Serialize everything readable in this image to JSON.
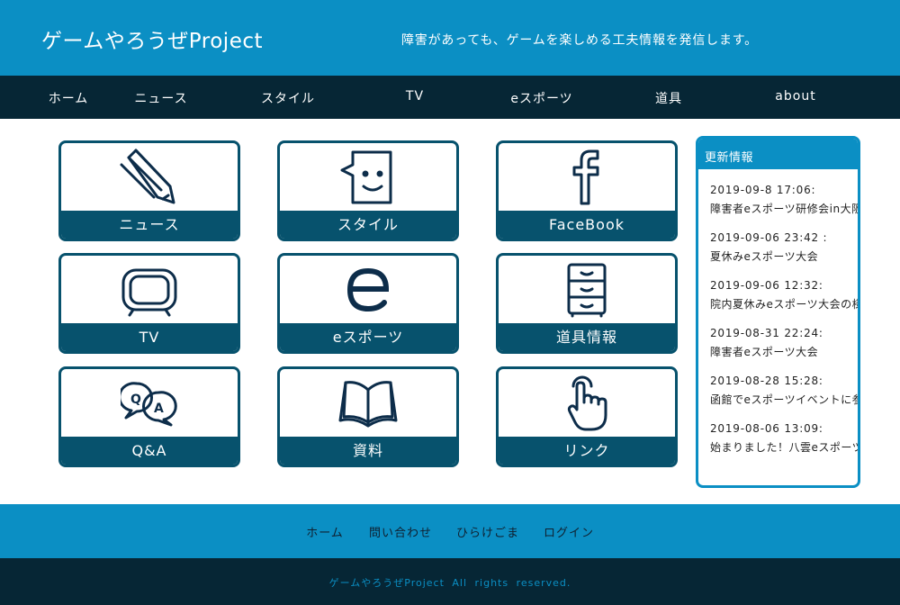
{
  "header": {
    "site_title": "ゲームやろうぜProject",
    "tagline": "障害があっても、ゲームを楽しめる工夫情報を発信します。"
  },
  "nav": {
    "items": [
      {
        "label": "ホーム"
      },
      {
        "label": "ニュース"
      },
      {
        "label": "スタイル"
      },
      {
        "label": "TV"
      },
      {
        "label": "eスポーツ"
      },
      {
        "label": "道具"
      },
      {
        "label": "about"
      }
    ]
  },
  "tiles": [
    {
      "label": "ニュース",
      "icon": "pencil-icon"
    },
    {
      "label": "スタイル",
      "icon": "face-speech-icon"
    },
    {
      "label": "FaceBook",
      "icon": "facebook-icon"
    },
    {
      "label": "TV",
      "icon": "tv-icon"
    },
    {
      "label": "eスポーツ",
      "icon": "e-letter-icon"
    },
    {
      "label": "道具情報",
      "icon": "cabinet-icon"
    },
    {
      "label": "Q&A",
      "icon": "qa-bubbles-icon"
    },
    {
      "label": "資料",
      "icon": "open-book-icon"
    },
    {
      "label": "リンク",
      "icon": "pointing-hand-icon"
    }
  ],
  "updates": {
    "title": "更新情報",
    "items": [
      {
        "date": "2019-09-8  17:06:",
        "title": "障害者eスポーツ研修会in大阪"
      },
      {
        "date": "2019-09-06  23:42  :",
        "title": "夏休みeスポーツ大会"
      },
      {
        "date": "2019-09-06  12:32:",
        "title": "院内夏休みeスポーツ大会の様子"
      },
      {
        "date": "2019-08-31  22:24:",
        "title": "障害者eスポーツ大会"
      },
      {
        "date": "2019-08-28  15:28:",
        "title": "函館でeスポーツイベントに参加"
      },
      {
        "date": "2019-08-06  13:09:",
        "title": "始まりました！八雲eスポーツ"
      }
    ]
  },
  "footer": {
    "links": [
      {
        "label": "ホーム"
      },
      {
        "label": "問い合わせ"
      },
      {
        "label": "ひらけごま"
      },
      {
        "label": "ログイン"
      }
    ],
    "copyright": "ゲームやろうぜProject  All rights reserved."
  },
  "colors": {
    "header_bg": "#0b8fc4",
    "nav_bg": "#062635",
    "tile_accent": "#07526d",
    "icon_stroke": "#0d2d4a"
  }
}
